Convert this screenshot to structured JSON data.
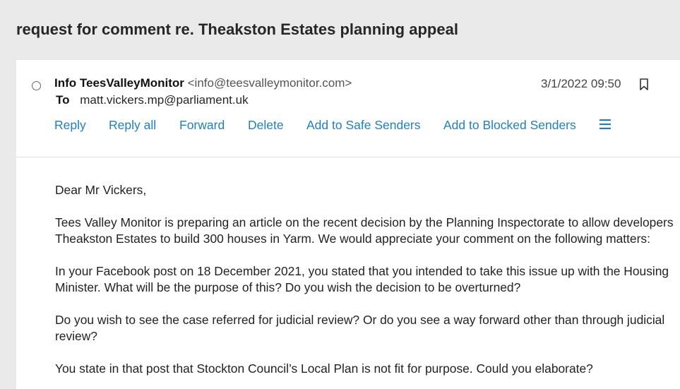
{
  "email": {
    "subject": "request for comment re. Theakston Estates planning appeal",
    "sender_name": "Info TeesValleyMonitor",
    "sender_email": "<info@teesvalleymonitor.com>",
    "to_label": "To",
    "to_address": "matt.vickers.mp@parliament.uk",
    "date": "3/1/2022 09:50"
  },
  "actions": {
    "reply": "Reply",
    "reply_all": "Reply all",
    "forward": "Forward",
    "delete": "Delete",
    "safe_senders": "Add to Safe Senders",
    "blocked_senders": "Add to Blocked Senders"
  },
  "icons": {
    "select": "radio-circle-icon",
    "flag": "bookmark-icon",
    "more": "hamburger-menu-icon"
  },
  "colors": {
    "link": "#1f7fc2",
    "background": "#eaeaea",
    "card": "#ffffff"
  },
  "body": {
    "greeting": "Dear Mr Vickers,",
    "para1": "Tees Valley Monitor is preparing an article on the recent decision by the Planning Inspectorate to allow developers Theakston Estates to build 300 houses in Yarm.  We would appreciate your comment on the following matters:",
    "para2": "In your Facebook post on 18 December 2021, you stated that you intended to take this issue up with the Housing Minister.  What will be the purpose of this?  Do you wish the decision to be overturned?",
    "para3": "Do you wish to see the case referred for judicial review? Or do you see a way forward other than through judicial review?",
    "para4": "You state in that post that Stockton Council’s Local Plan is not fit for purpose.  Could you elaborate?"
  }
}
